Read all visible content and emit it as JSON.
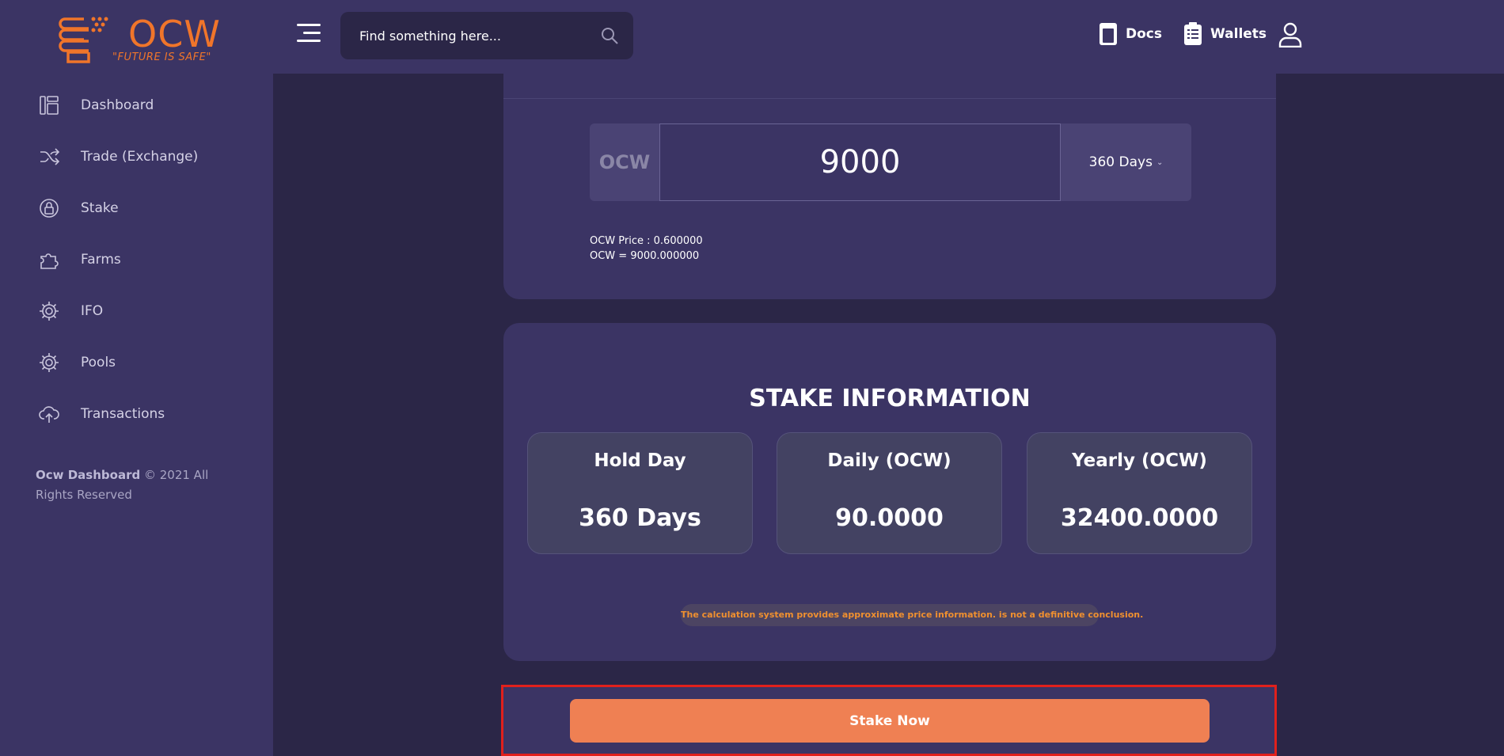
{
  "brand": {
    "name": "OCW",
    "tagline": "\"FUTURE IS SAFE\"",
    "color": "#f0752a"
  },
  "sidebar": {
    "items": [
      {
        "label": "Dashboard",
        "icon": "dashboard-icon"
      },
      {
        "label": "Trade (Exchange)",
        "icon": "shuffle-icon"
      },
      {
        "label": "Stake",
        "icon": "stake-icon"
      },
      {
        "label": "Farms",
        "icon": "puzzle-icon"
      },
      {
        "label": "IFO",
        "icon": "gear-icon"
      },
      {
        "label": "Pools",
        "icon": "gear-icon"
      },
      {
        "label": "Transactions",
        "icon": "cloud-upload-icon"
      }
    ],
    "copyright_brand": "Ocw Dashboard",
    "copyright_text": " © 2021 All Rights Reserved"
  },
  "header": {
    "search_placeholder": "Find something here...",
    "docs_label": "Docs",
    "wallets_label": "Wallets"
  },
  "stake_form": {
    "currency": "OCW",
    "amount": "9000",
    "period": "360 Days",
    "price_line": "OCW Price : 0.600000",
    "value_line": "OCW = 9000.000000"
  },
  "stake_info": {
    "title": "STAKE INFORMATION",
    "stats": [
      {
        "label": "Hold Day",
        "value": "360 Days"
      },
      {
        "label": "Daily (OCW)",
        "value": "90.0000"
      },
      {
        "label": "Yearly (OCW)",
        "value": "32400.0000"
      }
    ],
    "disclaimer": "The calculation system provides approximate price information. is not a definitive conclusion."
  },
  "actions": {
    "stake_now_label": "Stake Now",
    "button_color": "#ef8053"
  }
}
